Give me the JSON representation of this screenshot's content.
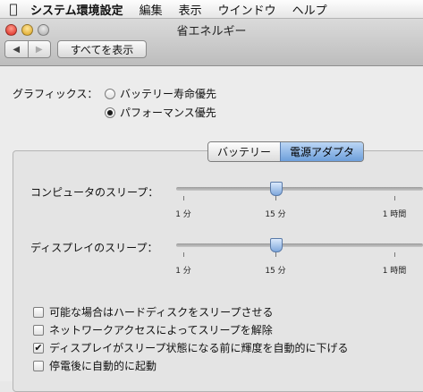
{
  "menubar": {
    "apple_icon": "apple-icon",
    "items": [
      "システム環境設定",
      "編集",
      "表示",
      "ウインドウ",
      "ヘルプ"
    ]
  },
  "window": {
    "title": "省エネルギー",
    "back_glyph": "◀",
    "forward_glyph": "▶",
    "show_all_label": "すべてを表示"
  },
  "graphics": {
    "label": "グラフィックス：",
    "options": [
      {
        "label": "バッテリー寿命優先",
        "selected": false
      },
      {
        "label": "パフォーマンス優先",
        "selected": true
      }
    ]
  },
  "tabs": [
    {
      "label": "バッテリー",
      "active": false
    },
    {
      "label": "電源アダプタ",
      "active": true
    }
  ],
  "sliders": [
    {
      "label": "コンピュータのスリープ：",
      "value_label": "15 分",
      "ticks": [
        "1 分",
        "15 分",
        "1 時間"
      ]
    },
    {
      "label": "ディスプレイのスリープ：",
      "value_label": "15 分",
      "ticks": [
        "1 分",
        "15 分",
        "1 時間"
      ]
    }
  ],
  "checkboxes": [
    {
      "label": "可能な場合はハードディスクをスリープさせる",
      "checked": false
    },
    {
      "label": "ネットワークアクセスによってスリープを解除",
      "checked": false
    },
    {
      "label": "ディスプレイがスリープ状態になる前に輝度を自動的に下げる",
      "checked": true
    },
    {
      "label": "停電後に自動的に起動",
      "checked": false
    }
  ],
  "colors": {
    "accent": "#6d9fdb",
    "background": "#ececec"
  }
}
